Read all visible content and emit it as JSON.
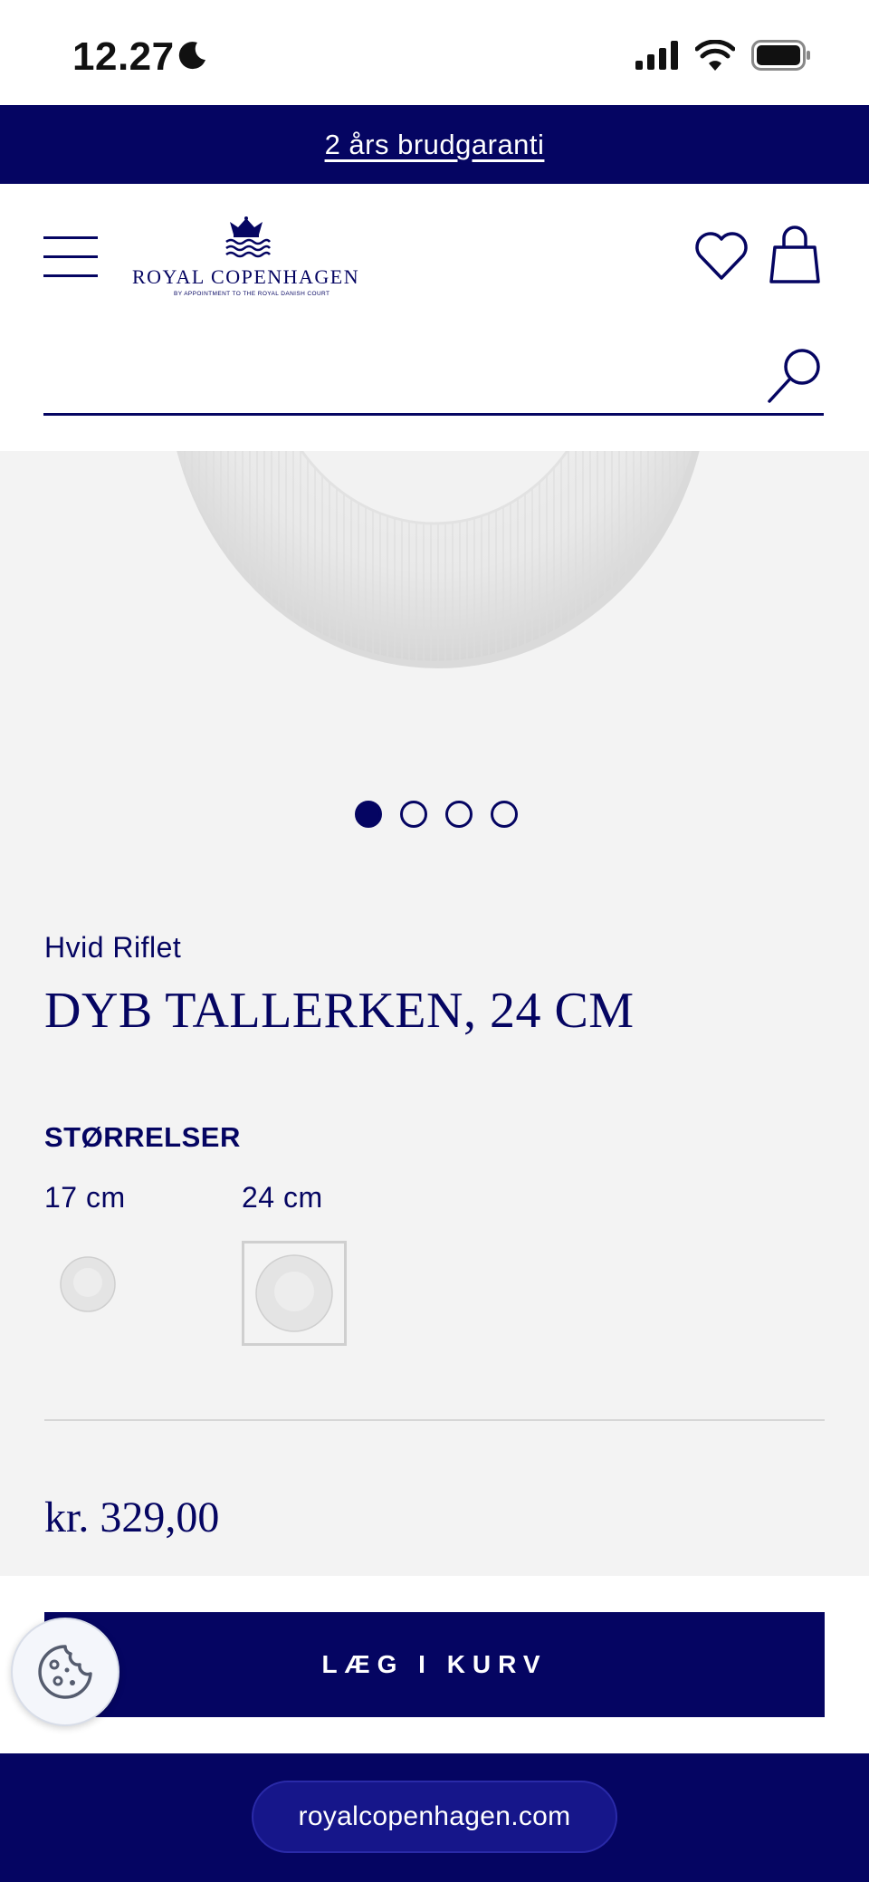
{
  "status_bar": {
    "time": "12.27",
    "icons": [
      "moon-icon",
      "signal-icon",
      "wifi-icon",
      "battery-icon"
    ]
  },
  "promo": {
    "text": "2 års brudgaranti"
  },
  "header": {
    "logo_text": "ROYAL COPENHAGEN",
    "logo_subtext": "BY APPOINTMENT TO THE ROYAL DANISH COURT",
    "search_placeholder": "",
    "icons": [
      "menu-icon",
      "heart-icon",
      "bag-icon",
      "search-icon"
    ]
  },
  "product": {
    "carousel": {
      "total": 4,
      "active_index": 0
    },
    "collection": "Hvid Riflet",
    "title": "DYB TALLERKEN, 24 CM",
    "sizes_heading": "STØRRELSER",
    "sizes": [
      {
        "label": "17 cm",
        "selected": false
      },
      {
        "label": "24 cm",
        "selected": true
      }
    ],
    "price": "kr. 329,00"
  },
  "cart": {
    "button_label": "LÆG I KURV"
  },
  "browser": {
    "url": "royalcopenhagen.com"
  },
  "colors": {
    "brand_navy": "#050562",
    "page_gray": "#f3f3f3"
  }
}
